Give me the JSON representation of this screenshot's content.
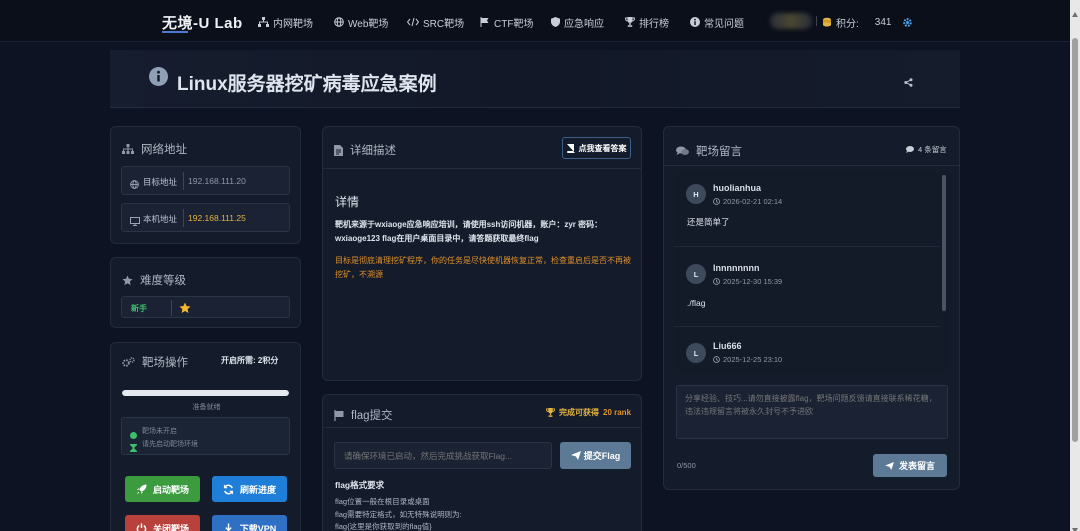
{
  "nav": {
    "brand": "无境-U Lab",
    "items": [
      {
        "label": "内网靶场",
        "icon": "network-icon"
      },
      {
        "label": "Web靶场",
        "icon": "globe-icon"
      },
      {
        "label": "SRC靶场",
        "icon": "code-icon"
      },
      {
        "label": "CTF靶场",
        "icon": "flag-icon"
      },
      {
        "label": "应急响应",
        "icon": "shield-icon"
      },
      {
        "label": "排行榜",
        "icon": "trophy-icon"
      },
      {
        "label": "常见问题",
        "icon": "info-icon"
      }
    ],
    "points_label": "积分:",
    "points_value": "341"
  },
  "page": {
    "title": "Linux服务器挖矿病毒应急案例"
  },
  "network": {
    "title": "网络地址",
    "target_label": "目标地址",
    "target_value": "192.168.111.20",
    "local_label": "本机地址",
    "local_value": "192.168.111.25"
  },
  "difficulty": {
    "title": "难度等级",
    "level": "新手"
  },
  "ops": {
    "title": "靶场操作",
    "cost": "开启所需: 2积分",
    "progress_text": "准备就绪",
    "progress_fraction": 1.0,
    "status_1": "靶场未开启",
    "status_2": "请先启动靶场环境",
    "start_label": "启动靶场",
    "refresh_label": "刷新进度",
    "close_label": "关闭靶场",
    "vpn_label": "下载VPN",
    "colors": {
      "start": "#3c9a3f",
      "refresh": "#1f7fd8",
      "close": "#b8423b",
      "vpn": "#2f6fc4"
    }
  },
  "detail": {
    "title": "详细描述",
    "answer_btn": "点我查看答案",
    "section": "详情",
    "text": "靶机来源于wxiaoge应急响应培训，请使用ssh访问机器，账户：zyr 密码：wxiaoge123 flag在用户桌面目录中，请答题获取最终flag",
    "goal": "目标是彻底清理挖矿程序，你的任务是尽快使机器恢复正常，检查重启后是否不再被挖矿，不溯源"
  },
  "flag": {
    "title": "flag提交",
    "reward_prefix": "完成可获得",
    "reward_value": "20 rank",
    "placeholder": "请确保环境已启动，然后完成挑战获取Flag...",
    "submit": "提交Flag",
    "format_title": "flag格式要求",
    "format_lines": [
      "flag位置一般在根目录或桌面",
      "flag需要特定格式，如无特殊说明则为:",
      "flag{这里是你获取到的flag值}"
    ]
  },
  "comments": {
    "title": "靶场留言",
    "count": "4 条留言",
    "items": [
      {
        "initial": "H",
        "user": "huolianhua",
        "time": "2026-02-21 02:14",
        "text": "还是简单了"
      },
      {
        "initial": "L",
        "user": "lnnnnnnnn",
        "time": "2025-12-30 15:39",
        "text": "./flag"
      },
      {
        "initial": "L",
        "user": "Liu666",
        "time": "2025-12-25 23:10",
        "text": ""
      }
    ],
    "placeholder": "分享经验、技巧...请勿直接披露flag，靶场问题反馈请直接联系稀花糖，违法违规留言将被永久封号不予进欧",
    "char_count": "0/500",
    "post_label": "发表留言"
  },
  "colors": {
    "accent": "#4a7bd0",
    "orange": "#e0902a",
    "gold": "#e3b341",
    "green": "#3fbf6a"
  }
}
